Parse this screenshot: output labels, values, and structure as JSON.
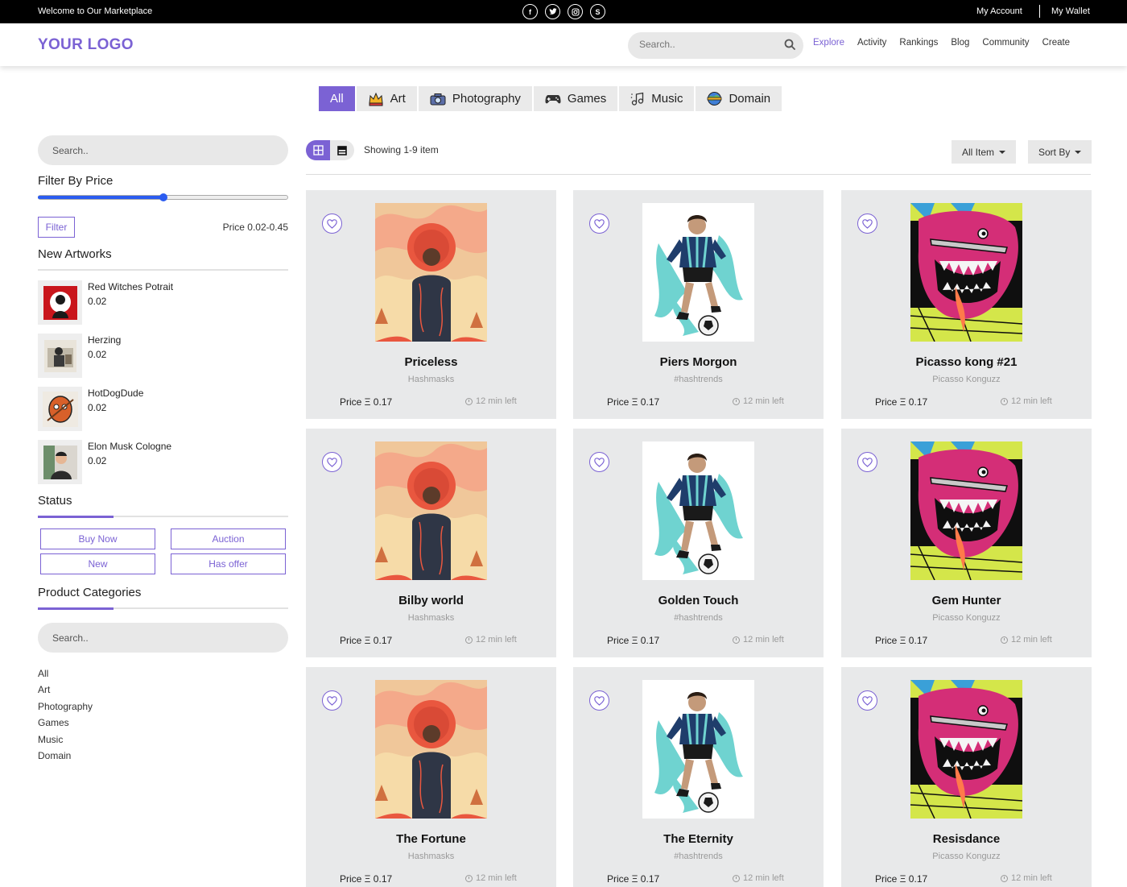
{
  "topbar": {
    "welcome": "Welcome to Our Marketplace",
    "socials": [
      "facebook-icon",
      "twitter-icon",
      "instagram-icon",
      "skype-icon"
    ],
    "my_account": "My Account",
    "my_wallet": "My Wallet"
  },
  "header": {
    "logo": "YOUR LOGO",
    "search_placeholder": "Search..",
    "nav": [
      "Explore",
      "Activity",
      "Rankings",
      "Blog",
      "Community",
      "Create"
    ],
    "active_nav": "Explore"
  },
  "categories": [
    {
      "label": "All",
      "icon": "",
      "active": true
    },
    {
      "label": "Art",
      "icon": "crown-icon"
    },
    {
      "label": "Photography",
      "icon": "camera-icon"
    },
    {
      "label": "Games",
      "icon": "gamepad-icon"
    },
    {
      "label": "Music",
      "icon": "music-icon"
    },
    {
      "label": "Domain",
      "icon": "globe-icon"
    }
  ],
  "sidebar": {
    "search_placeholder": "Search..",
    "filter_by_price": "Filter By Price",
    "price_slider_level": 0.5,
    "filter_button": "Filter",
    "price_range": "Price 0.02-0.45",
    "new_artworks_title": "New Artworks",
    "new_artworks": [
      {
        "title": "Red Witches Potrait",
        "price": "0.02"
      },
      {
        "title": "Herzing",
        "price": "0.02"
      },
      {
        "title": "HotDogDude",
        "price": "0.02"
      },
      {
        "title": "Elon Musk Cologne",
        "price": "0.02"
      }
    ],
    "status_title": "Status",
    "status_buttons": [
      "Buy Now",
      "Auction",
      "New",
      "Has offer"
    ],
    "product_categories_title": "Product Categories",
    "product_search_placeholder": "Search..",
    "product_categories": [
      "All",
      "Art",
      "Photography",
      "Games",
      "Music",
      "Domain"
    ]
  },
  "toolbar": {
    "showing": "Showing 1-9 item",
    "all_item": "All Item",
    "sort_by": "Sort By"
  },
  "colors": {
    "accent": "#7b62d4",
    "slider": "#2b5cf0",
    "card_bg": "#e8e9ea"
  },
  "cards": [
    {
      "title": "Priceless",
      "owner": "Hashmasks",
      "price": "Price Ξ 0.17",
      "time": "12 min left",
      "art": "orange-figure"
    },
    {
      "title": "Piers Morgon",
      "owner": "#hashtrends",
      "price": "Price Ξ 0.17",
      "time": "12 min left",
      "art": "football-player"
    },
    {
      "title": "Picasso kong #21",
      "owner": "Picasso Konguzz",
      "price": "Price Ξ 0.17",
      "time": "12 min left",
      "art": "pink-monster"
    },
    {
      "title": "Bilby world",
      "owner": "Hashmasks",
      "price": "Price Ξ 0.17",
      "time": "12 min left",
      "art": "orange-figure"
    },
    {
      "title": "Golden Touch",
      "owner": "#hashtrends",
      "price": "Price Ξ 0.17",
      "time": "12 min left",
      "art": "football-player"
    },
    {
      "title": "Gem Hunter",
      "owner": "Picasso Konguzz",
      "price": "Price Ξ 0.17",
      "time": "12 min left",
      "art": "pink-monster"
    },
    {
      "title": "The Fortune",
      "owner": "Hashmasks",
      "price": "Price Ξ 0.17",
      "time": "12 min left",
      "art": "orange-figure"
    },
    {
      "title": "The Eternity",
      "owner": "#hashtrends",
      "price": "Price Ξ 0.17",
      "time": "12 min left",
      "art": "football-player"
    },
    {
      "title": "Resisdance",
      "owner": "Picasso Konguzz",
      "price": "Price Ξ 0.17",
      "time": "12 min left",
      "art": "pink-monster"
    }
  ]
}
